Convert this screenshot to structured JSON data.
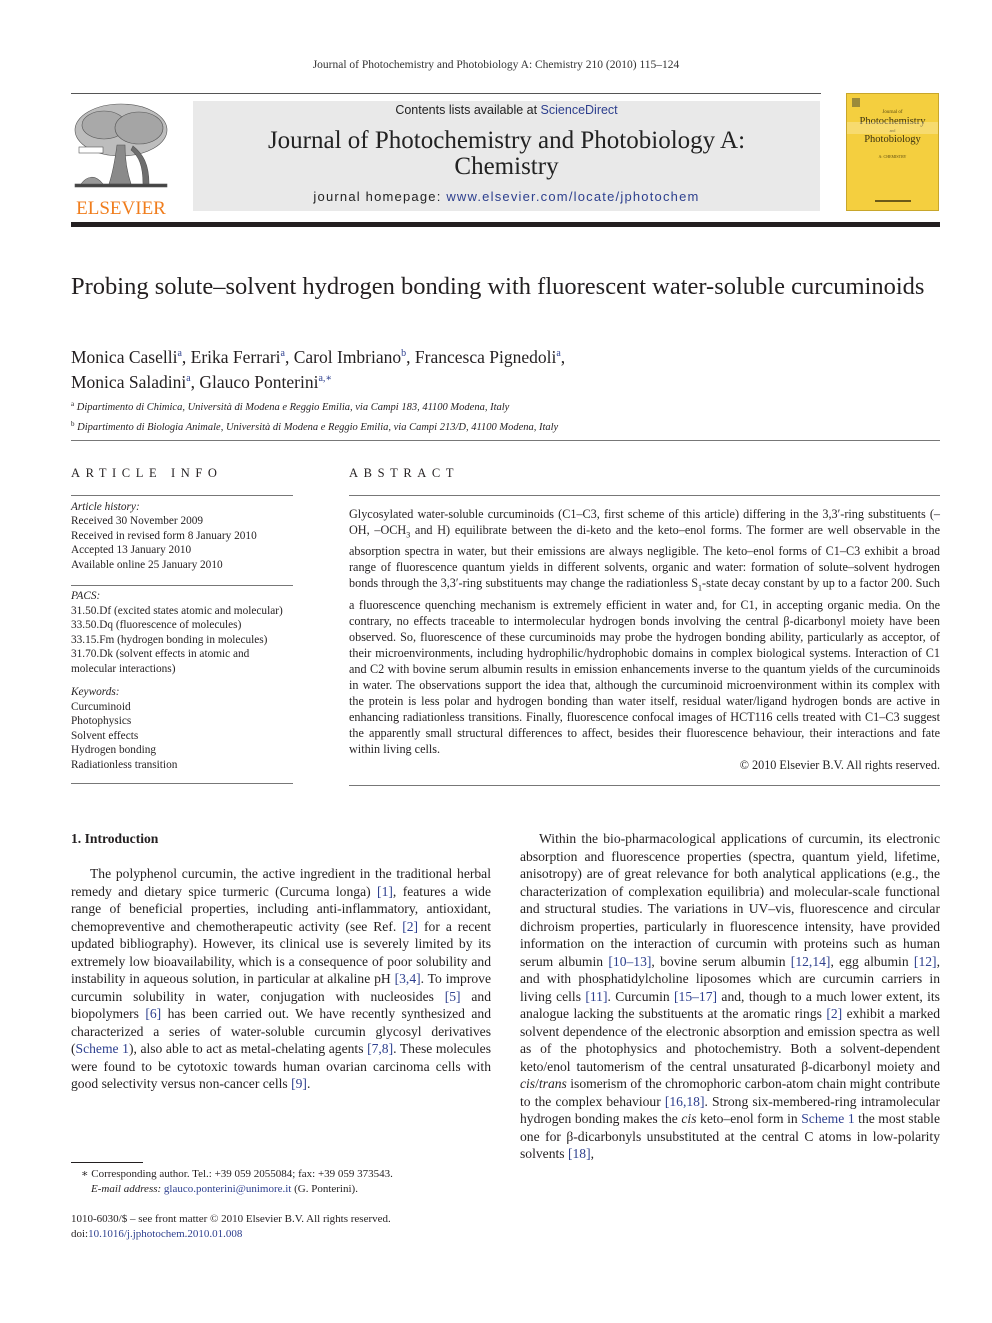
{
  "running_head": "Journal of Photochemistry and Photobiology A: Chemistry 210 (2010) 115–124",
  "publisher": {
    "logo_word": "ELSEVIER",
    "logo_icon": "elsevier-tree-icon",
    "brand_color": "#f07d1d"
  },
  "banner": {
    "contents_prefix": "Contents lists available at ",
    "contents_link": "ScienceDirect",
    "journal_title_line1": "Journal of Photochemistry and Photobiology A:",
    "journal_title_line2": "Chemistry",
    "homepage_prefix": "journal homepage: ",
    "homepage_link": "www.elsevier.com/locate/jphotochem",
    "background": "#e9e9e9",
    "link_color": "#2d3f8e"
  },
  "cover": {
    "small": "Journal of",
    "line1": "Photochemistry",
    "and": "and",
    "line2": "Photobiology",
    "sub": "A: CHEMISTRY",
    "color": "#f4cf3f"
  },
  "article": {
    "title": "Probing solute–solvent hydrogen bonding with fluorescent water-soluble curcuminoids",
    "authors": [
      {
        "name": "Monica Caselli",
        "aff": "a",
        "sep": ", "
      },
      {
        "name": "Erika Ferrari",
        "aff": "a",
        "sep": ", "
      },
      {
        "name": "Carol Imbriano",
        "aff": "b",
        "sep": ", "
      },
      {
        "name": "Francesca Pignedoli",
        "aff": "a",
        "sep": ","
      },
      {
        "name": "Monica Saladini",
        "aff": "a",
        "sep": ", "
      },
      {
        "name": "Glauco Ponterini",
        "aff": "a,∗",
        "sep": ""
      }
    ],
    "affiliations": [
      {
        "mark": "a",
        "text": "Dipartimento di Chimica, Università di Modena e Reggio Emilia, via Campi 183, 41100 Modena, Italy"
      },
      {
        "mark": "b",
        "text": "Dipartimento di Biologia Animale, Università di Modena e Reggio Emilia, via Campi 213/D, 41100 Modena, Italy"
      }
    ]
  },
  "article_info": {
    "heading": "ARTICLE INFO",
    "history_title": "Article history:",
    "history": [
      "Received 30 November 2009",
      "Received in revised form 8 January 2010",
      "Accepted 13 January 2010",
      "Available online 25 January 2010"
    ],
    "pacs_title": "PACS:",
    "pacs": [
      "31.50.Df (excited states atomic and molecular)",
      "33.50.Dq (fluorescence of molecules)",
      "33.15.Fm (hydrogen bonding in molecules)",
      "31.70.Dk (solvent effects in atomic and molecular interactions)"
    ],
    "keywords_title": "Keywords:",
    "keywords": [
      "Curcuminoid",
      "Photophysics",
      "Solvent effects",
      "Hydrogen bonding",
      "Radiationless transition"
    ]
  },
  "abstract": {
    "heading": "ABSTRACT",
    "p1": "Glycosylated water-soluble curcuminoids (C1–C3, first scheme of this article) differing in the 3,3′-ring substituents (–OH, –OCH",
    "sub3": "3",
    "p2": " and H) equilibrate between the di-keto and the keto–enol forms. The former are well observable in the absorption spectra in water, but their emissions are always negligible. The keto–enol forms of C1–C3 exhibit a broad range of fluorescence quantum yields in different solvents, organic and water: formation of solute–solvent hydrogen bonds through the 3,3′-ring substituents may change the radiationless S",
    "sub1": "1",
    "p3": "-state decay constant by up to a factor 200. Such a fluorescence quenching mechanism is extremely efficient in water and, for C1, in accepting organic media. On the contrary, no effects traceable to intermolecular hydrogen bonds involving the central β-dicarbonyl moiety have been observed. So, fluorescence of these curcuminoids may probe the hydrogen bonding ability, particularly as acceptor, of their microenvironments, including hydrophilic/hydrophobic domains in complex biological systems. Interaction of C1 and C2 with bovine serum albumin results in emission enhancements inverse to the quantum yields of the curcuminoids in water. The observations support the idea that, although the curcuminoid microenvironment within its complex with the protein is less polar and hydrogen bonding than water itself, residual water/ligand hydrogen bonds are active in enhancing radiationless transitions. Finally, fluorescence confocal images of HCT116 cells treated with C1–C3 suggest the apparently small structural differences to affect, besides their fluorescence behaviour, their interactions and fate within living cells.",
    "copyright": "© 2010 Elsevier B.V. All rights reserved."
  },
  "intro": {
    "heading": "1.  Introduction",
    "left_segments": [
      {
        "t": "The polyphenol curcumin, the active ingredient in the traditional herbal remedy and dietary spice turmeric (Curcuma longa) "
      },
      {
        "l": "[1]"
      },
      {
        "t": ", features a wide range of beneficial properties, including anti-inflammatory, antioxidant, chemopreventive and chemotherapeutic activity (see Ref. "
      },
      {
        "l": "[2]"
      },
      {
        "t": " for a recent updated bibliography). However, its clinical use is severely limited by its extremely low bioavailability, which is a consequence of poor solubility and instability in aqueous solution, in particular at alkaline pH "
      },
      {
        "l": "[3,4]"
      },
      {
        "t": ". To improve curcumin solubility in water, conjugation with nucleosides "
      },
      {
        "l": "[5]"
      },
      {
        "t": " and biopolymers "
      },
      {
        "l": "[6]"
      },
      {
        "t": " has been carried out. We have recently synthesized and characterized a series of water-soluble curcumin glycosyl derivatives ("
      },
      {
        "l": "Scheme 1"
      },
      {
        "t": "), also able to act as metal-chelating agents "
      },
      {
        "l": "[7,8]"
      },
      {
        "t": ". These molecules were found to be cytotoxic towards human ovarian carcinoma cells with good selectivity versus non-cancer cells "
      },
      {
        "l": "[9]"
      },
      {
        "t": "."
      }
    ],
    "right_segments": [
      {
        "t": "Within the bio-pharmacological applications of curcumin, its electronic absorption and fluorescence properties (spectra, quantum yield, lifetime, anisotropy) are of great relevance for both analytical applications (e.g., the characterization of complexation equilibria) and molecular-scale functional and structural studies. The variations in UV–vis, fluorescence and circular dichroism properties, particularly in fluorescence intensity, have provided information on the interaction of curcumin with proteins such as human serum albumin "
      },
      {
        "l": "[10–13]"
      },
      {
        "t": ", bovine serum albumin "
      },
      {
        "l": "[12,14]"
      },
      {
        "t": ", egg albumin "
      },
      {
        "l": "[12]"
      },
      {
        "t": ", and with phosphatidylcholine liposomes which are curcumin carriers in living cells "
      },
      {
        "l": "[11]"
      },
      {
        "t": ". Curcumin "
      },
      {
        "l": "[15–17]"
      },
      {
        "t": " and, though to a much lower extent, its analogue lacking the substituents at the aromatic rings "
      },
      {
        "l": "[2]"
      },
      {
        "t": " exhibit a marked solvent dependence of the electronic absorption and emission spectra as well as of the photophysics and photochemistry. Both a solvent-dependent keto/enol tautomerism of the central unsaturated β-dicarbonyl moiety and "
      },
      {
        "i": "cis"
      },
      {
        "t": "/"
      },
      {
        "i": "trans"
      },
      {
        "t": " isomerism of the chromophoric carbon-atom chain might contribute to the complex behaviour "
      },
      {
        "l": "[16,18]"
      },
      {
        "t": ". Strong six-membered-ring intramolecular hydrogen bonding makes the "
      },
      {
        "i": "cis"
      },
      {
        "t": " keto–enol form in "
      },
      {
        "l": "Scheme 1"
      },
      {
        "t": " the most stable one for β-dicarbonyls unsubstituted at the central C atoms in low-polarity solvents "
      },
      {
        "l": "[18]"
      },
      {
        "t": ","
      }
    ]
  },
  "footnote": {
    "mark": "∗",
    "corresponding": " Corresponding author. Tel.: +39 059 2055084; fax: +39 059 373543.",
    "email_label": "E-mail address:",
    "email": "glauco.ponterini@unimore.it",
    "email_suffix": " (G. Ponterini)."
  },
  "frontmatter": {
    "issn_line": "1010-6030/$ – see front matter © 2010 Elsevier B.V. All rights reserved.",
    "doi_prefix": "doi:",
    "doi": "10.1016/j.jphotochem.2010.01.008"
  }
}
